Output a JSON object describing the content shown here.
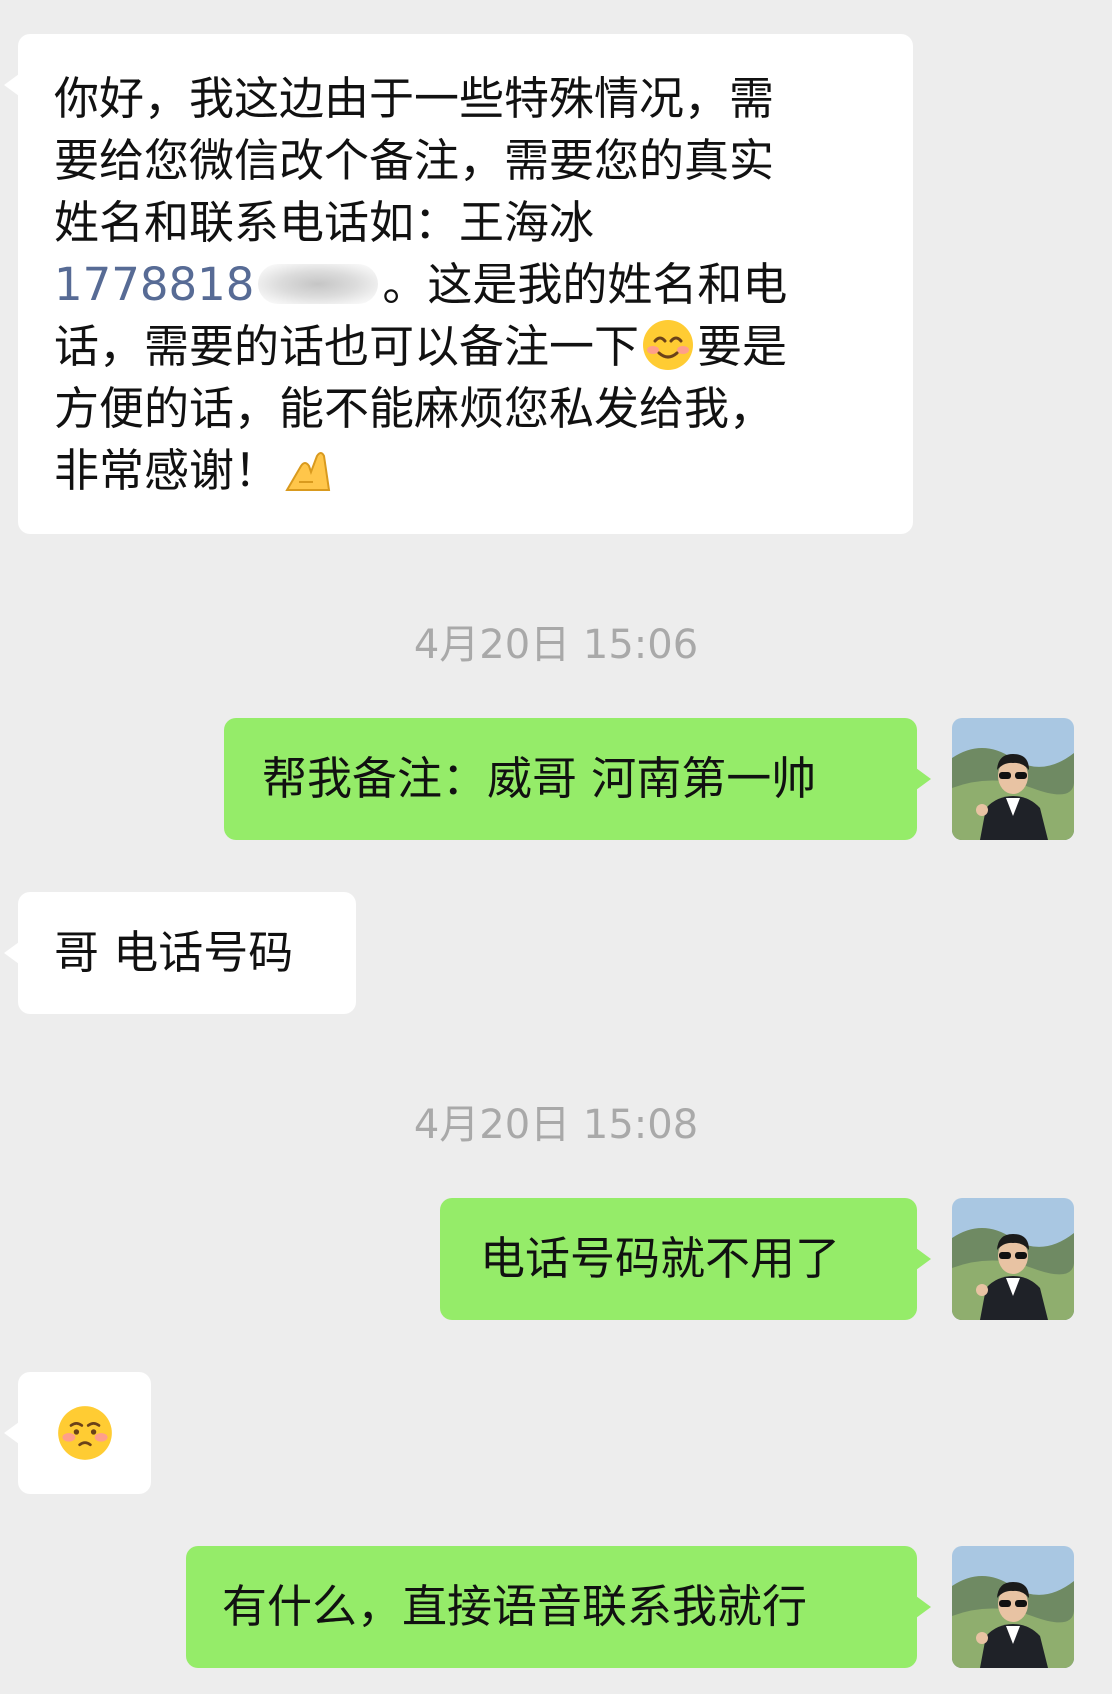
{
  "messages": {
    "m1": {
      "lines": [
        "你好，我这边由于一些特殊情况，需",
        "要给您微信改个备注，需要您的真实",
        "姓名和联系电话如：王海冰"
      ],
      "phone_visible": "1778818",
      "line4_rest": "。这是我的姓名和电",
      "line5_a": "话，需要的话也可以备注一下",
      "line5_b": "要是",
      "line6": "方便的话，能不能麻烦您私发给我，",
      "line7": "非常感谢！"
    },
    "m2": {
      "text": "帮我备注：威哥 河南第一帅"
    },
    "m3": {
      "text": "哥 电话号码"
    },
    "m4": {
      "text": "电话号码就不用了"
    },
    "m6": {
      "text": "有什么，直接语音联系我就行"
    }
  },
  "timestamps": [
    "4月20日 15:06",
    "4月20日 15:08"
  ],
  "icons": {
    "smile": "smiling-face-icon",
    "hands": "ok-hand-icon",
    "shy": "flushed-face-icon"
  },
  "colors": {
    "background": "#ededed",
    "incoming_bubble": "#ffffff",
    "outgoing_bubble": "#95ec69",
    "link": "#576b95",
    "timestamp": "#a9a9a9"
  }
}
